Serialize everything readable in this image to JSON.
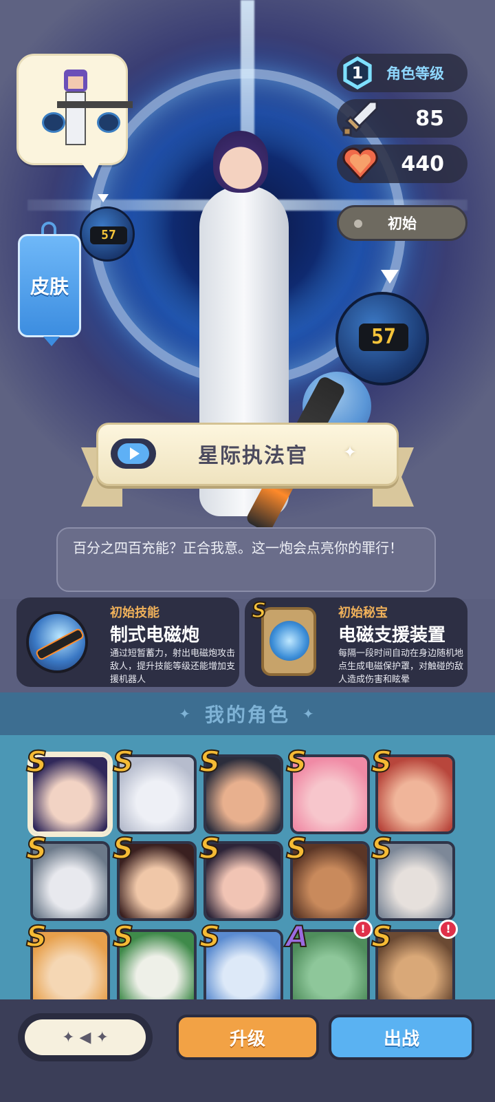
{
  "hero": {
    "character_name": "星际执法官",
    "quote": "百分之四百充能？正合我意。这一炮会点亮你的罪行！",
    "orb_small_value": "57",
    "orb_big_value": "57"
  },
  "skin_button_label": "皮肤",
  "stats": {
    "level_value": "1",
    "level_label": "角色等级",
    "attack": "85",
    "hp": "440",
    "stage_label": "初始"
  },
  "skills": {
    "initial_skill": {
      "header": "初始技能",
      "name": "制式电磁炮",
      "description": "通过短暂蓄力，射出电磁炮攻击敌人，提升技能等级还能增加支援机器人"
    },
    "initial_treasure": {
      "header": "初始秘宝",
      "rank": "S",
      "name": "电磁支援装置",
      "description": "每隔一段时间自动在身边随机地点生成电磁保护罩，对触碰的敌人造成伤害和眩晕"
    }
  },
  "roster": {
    "title": "我的角色",
    "items": [
      {
        "rank": "S",
        "selected": true,
        "colors": [
          "#f2d3c4",
          "#30285a"
        ]
      },
      {
        "rank": "S",
        "colors": [
          "#eef0f6",
          "#b6bccd"
        ]
      },
      {
        "rank": "S",
        "colors": [
          "#e8b08e",
          "#2b2d3c"
        ]
      },
      {
        "rank": "S",
        "colors": [
          "#f7c6cc",
          "#f08aa5"
        ]
      },
      {
        "rank": "S",
        "colors": [
          "#f0b59a",
          "#b8463c"
        ]
      },
      {
        "rank": "S",
        "colors": [
          "#e8e9ee",
          "#6c7a8a"
        ]
      },
      {
        "rank": "S",
        "colors": [
          "#f0c7a8",
          "#3a2020"
        ]
      },
      {
        "rank": "S",
        "colors": [
          "#f1c4b4",
          "#2d2438"
        ]
      },
      {
        "rank": "S",
        "colors": [
          "#c98a5c",
          "#5b3626"
        ]
      },
      {
        "rank": "S",
        "colors": [
          "#e6e0dc",
          "#7d8898"
        ]
      },
      {
        "rank": "S",
        "colors": [
          "#f5d7b4",
          "#e7a04c"
        ]
      },
      {
        "rank": "S",
        "colors": [
          "#eef0e8",
          "#3f8a4a"
        ]
      },
      {
        "rank": "S",
        "colors": [
          "#dde9f8",
          "#5a8bd0"
        ]
      },
      {
        "rank": "A",
        "alert": "!",
        "colors": [
          "#8ec79a",
          "#4f8d5c"
        ]
      },
      {
        "rank": "S",
        "alert": "!",
        "colors": [
          "#d9a878",
          "#6b4a33"
        ]
      }
    ]
  },
  "bottom": {
    "upgrade_label": "升级",
    "deploy_label": "出战"
  }
}
